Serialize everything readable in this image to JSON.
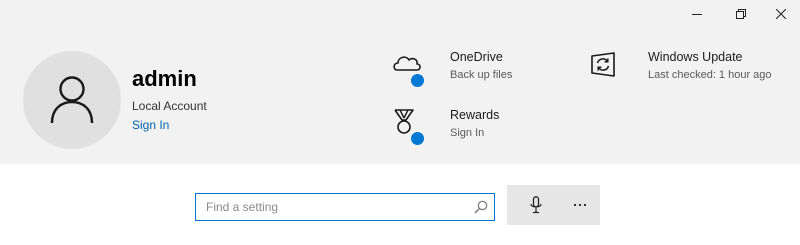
{
  "user": {
    "name": "admin",
    "account_type": "Local Account",
    "sign_in": "Sign In"
  },
  "tiles": [
    {
      "id": "onedrive",
      "title": "OneDrive",
      "subtitle": "Back up files",
      "icon": "cloud-icon"
    },
    {
      "id": "rewards",
      "title": "Rewards",
      "subtitle": "Sign In",
      "icon": "rewards-medal-icon"
    },
    {
      "id": "update",
      "title": "Windows Update",
      "subtitle": "Last checked: 1 hour ago",
      "icon": "windows-update-icon"
    }
  ],
  "search": {
    "placeholder": "Find a setting",
    "value": ""
  },
  "colors": {
    "accent": "#0078d4",
    "link": "#0063b1",
    "header_bg": "#f2f2f2"
  }
}
